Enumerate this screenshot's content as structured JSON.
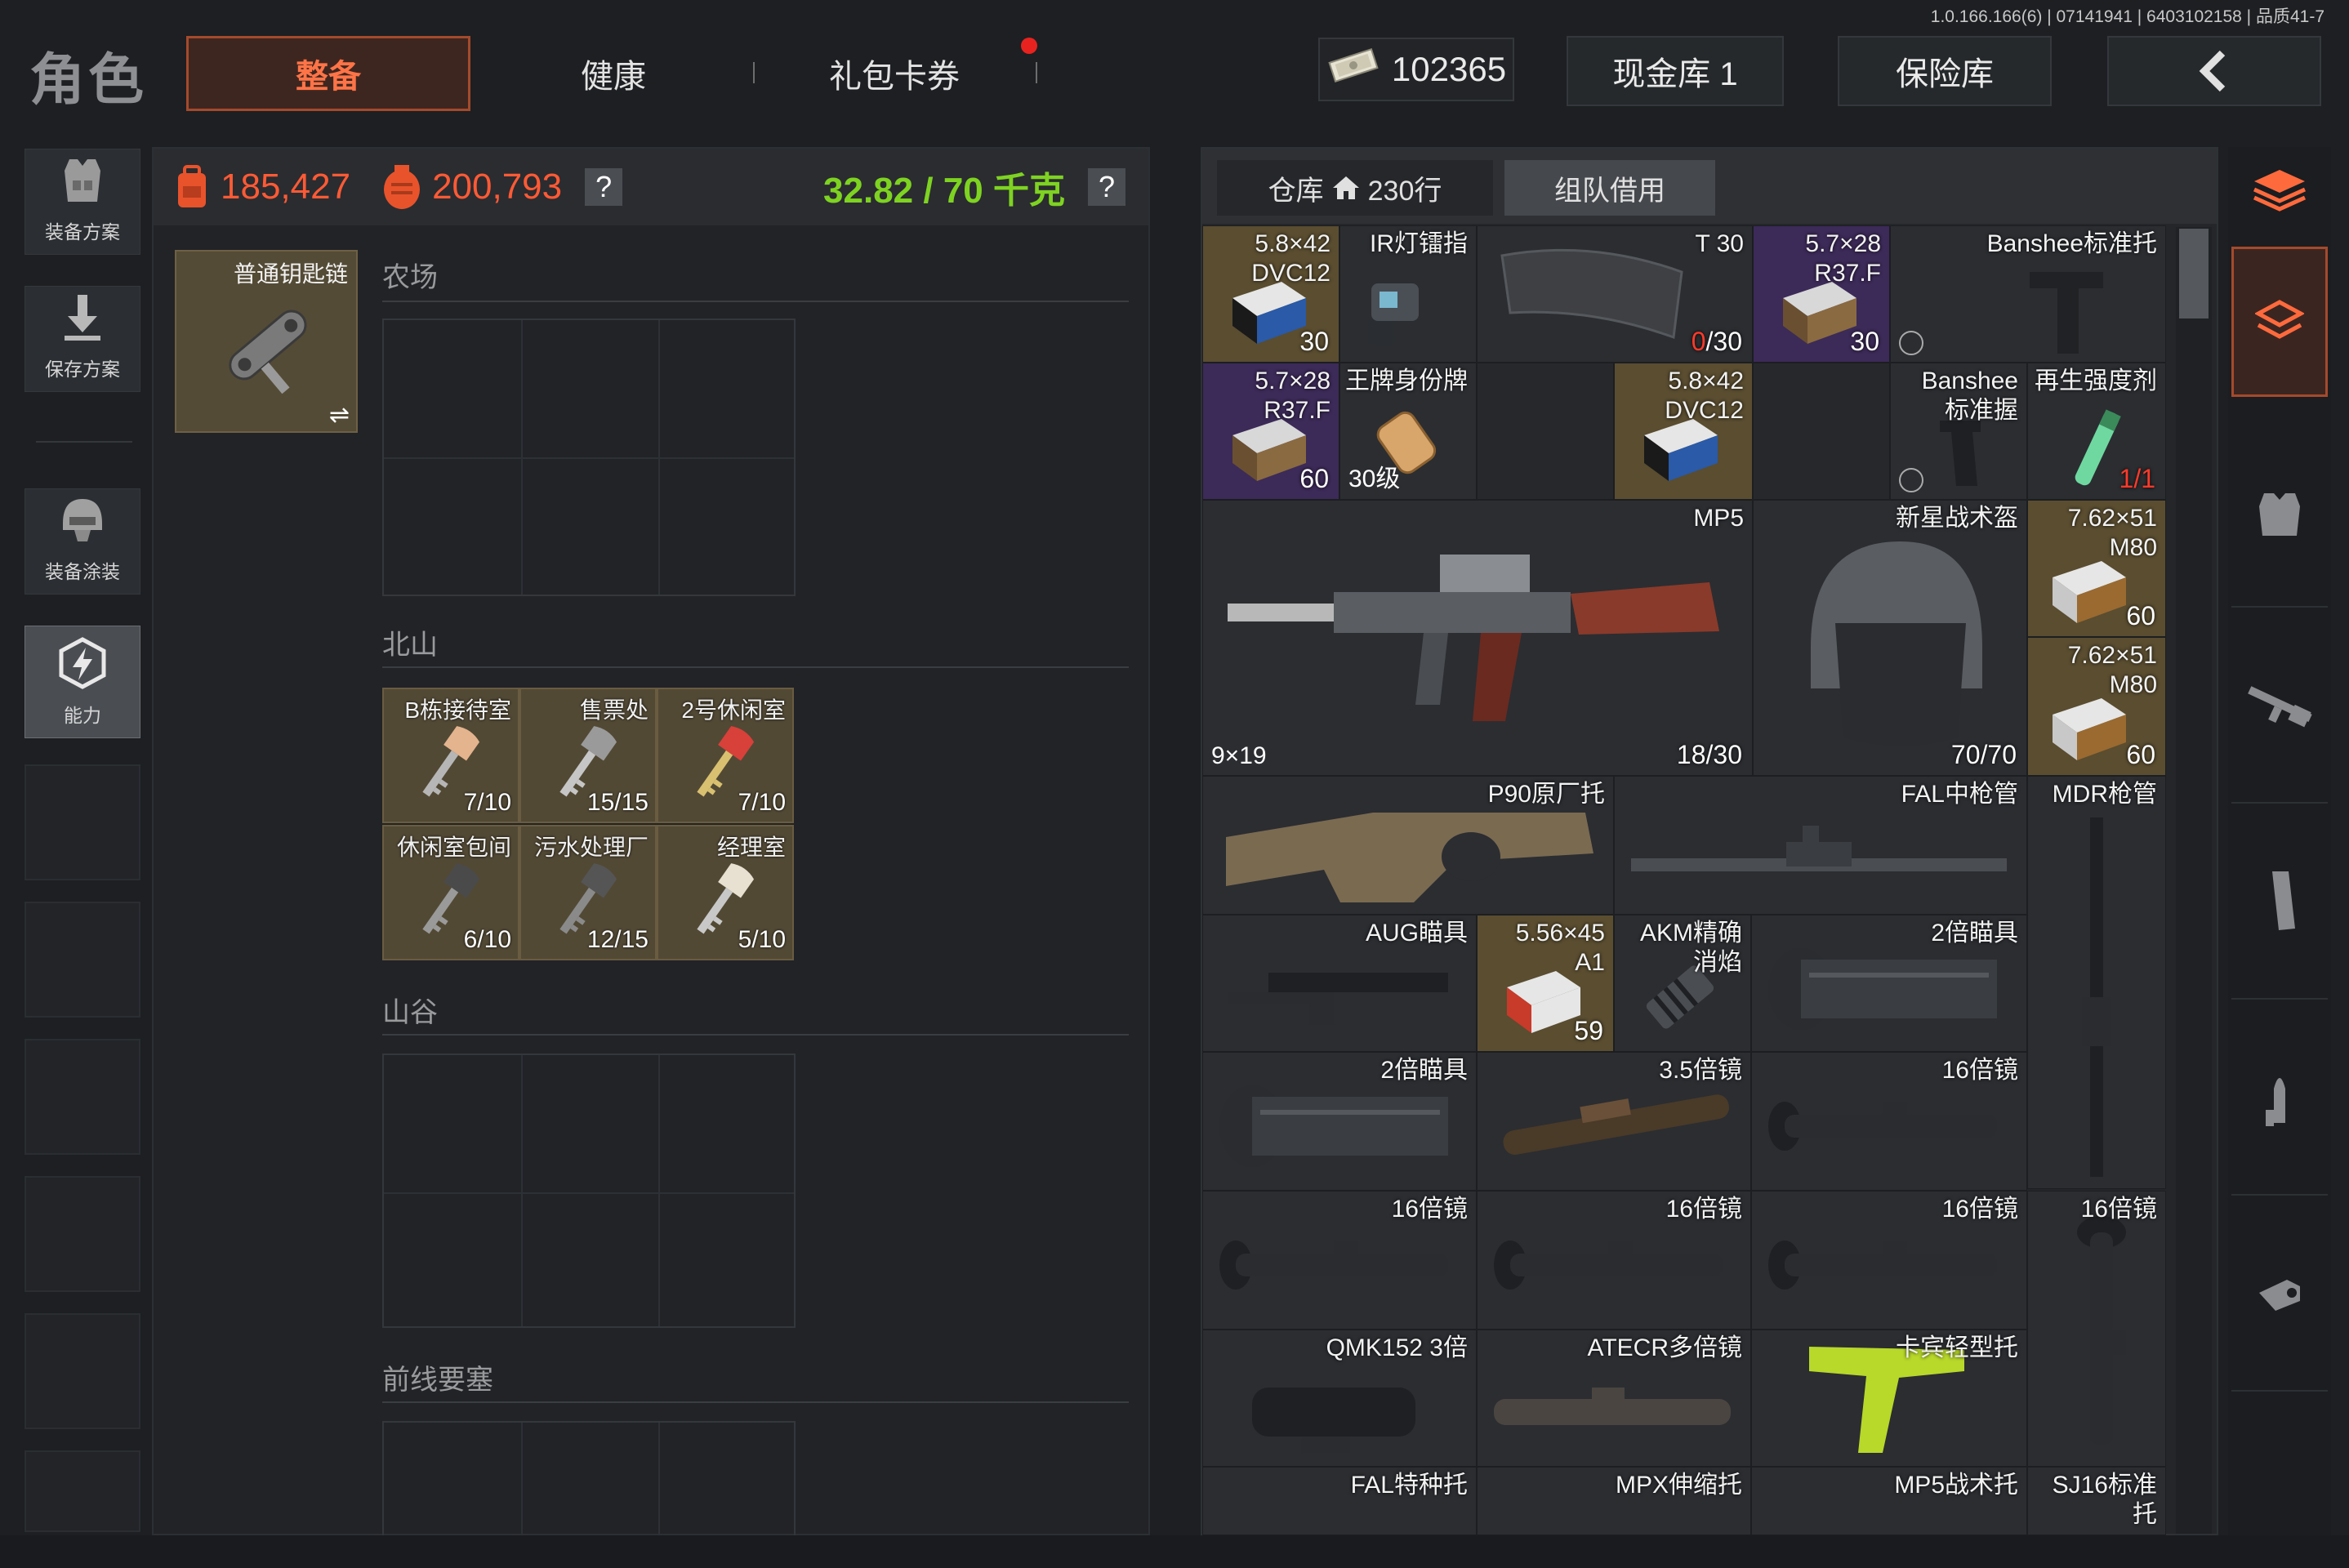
{
  "version": "1.0.166.166(6) | 07141941 | 6403102158 | 品质41-7",
  "page_title": "角色",
  "tabs": [
    {
      "label": "整备",
      "active": true
    },
    {
      "label": "健康",
      "active": false
    },
    {
      "label": "礼包卡券",
      "active": false,
      "notification": true
    }
  ],
  "currency": {
    "icon": "cash-icon",
    "amount": "102365"
  },
  "top_buttons": {
    "cash_vault": "现金库 1",
    "safe": "保险库",
    "back_icon": "back-arrow-icon"
  },
  "sidebar": [
    {
      "label": "装备方案",
      "icon": "vest-icon"
    },
    {
      "label": "保存方案",
      "icon": "download-icon"
    },
    {
      "label": "装备涂装",
      "icon": "helmet-skin-icon"
    },
    {
      "label": "能力",
      "icon": "ability-icon",
      "selected": true
    }
  ],
  "stats": {
    "backpack_value": "185,427",
    "total_value": "200,793",
    "weight": "32.82 / 70 千克",
    "help": "?"
  },
  "keychain": {
    "label": "普通钥匙链",
    "swap_icon": "swap-icon"
  },
  "key_sections": [
    {
      "title": "农场"
    },
    {
      "title": "北山",
      "keys": [
        {
          "name": "B栋接待室",
          "count": "7/10"
        },
        {
          "name": "售票处",
          "count": "15/15"
        },
        {
          "name": "2号休闲室",
          "count": "7/10"
        },
        {
          "name": "休闲室包间",
          "count": "6/10"
        },
        {
          "name": "污水处理厂",
          "count": "12/15"
        },
        {
          "name": "经理室",
          "count": "5/10"
        }
      ]
    },
    {
      "title": "山谷"
    },
    {
      "title": "前线要塞"
    }
  ],
  "inventory": {
    "tab_storage": "仓库",
    "tab_rows": "230行",
    "tab_team": "组队借用",
    "items": [
      {
        "name": "5.8×42 DVC12",
        "count": "30"
      },
      {
        "name": "IR灯镭指"
      },
      {
        "name": "T 30",
        "count_red": "0",
        "count": "/30"
      },
      {
        "name": "5.7×28 R37.F",
        "count": "30"
      },
      {
        "name": "Banshee标准托"
      },
      {
        "name": "5.7×28 R37.F",
        "count": "60"
      },
      {
        "name": "王牌身份牌",
        "cal": "30级"
      },
      {
        "name": "5.8×42 DVC12"
      },
      {
        "name": "Banshee 标准握"
      },
      {
        "name": "再生强度剂",
        "count": "1/1"
      },
      {
        "name": "MP5",
        "cal": "9×19",
        "count": "18/30"
      },
      {
        "name": "新星战术盔",
        "count": "70/70"
      },
      {
        "name": "7.62×51 M80",
        "count": "60"
      },
      {
        "name": "7.62×51 M80",
        "count": "60"
      },
      {
        "name": "P90原厂托"
      },
      {
        "name": "FAL中枪管"
      },
      {
        "name": "MDR枪管"
      },
      {
        "name": "AUG瞄具"
      },
      {
        "name": "5.56×45 A1",
        "count": "59"
      },
      {
        "name": "AKM精确 消焰"
      },
      {
        "name": "2倍瞄具"
      },
      {
        "name": "2倍瞄具"
      },
      {
        "name": "3.5倍镜"
      },
      {
        "name": "16倍镜"
      },
      {
        "name": "16倍镜"
      },
      {
        "name": "16倍镜"
      },
      {
        "name": "16倍镜"
      },
      {
        "name": "16倍镜"
      },
      {
        "name": "QMK152 3倍"
      },
      {
        "name": "ATECR多倍镜"
      },
      {
        "name": "卡宾轻型托"
      },
      {
        "name": "FAL特种托"
      },
      {
        "name": "MPX伸缩托"
      },
      {
        "name": "MP5战术托"
      },
      {
        "name": "SJ16标准 托"
      }
    ]
  },
  "filter_rail": [
    {
      "icon": "all-items-icon",
      "active": true
    },
    {
      "icon": "armor-icon"
    },
    {
      "icon": "rifle-icon"
    },
    {
      "icon": "magazine-icon"
    },
    {
      "icon": "ammo-icon"
    },
    {
      "icon": "scope-icon"
    }
  ],
  "colors": {
    "accent": "#ff6a3d",
    "value": "#ff5a35",
    "weight": "#7ed321",
    "gold_item": "#5a4d30",
    "purple_item": "#3c2a58"
  }
}
